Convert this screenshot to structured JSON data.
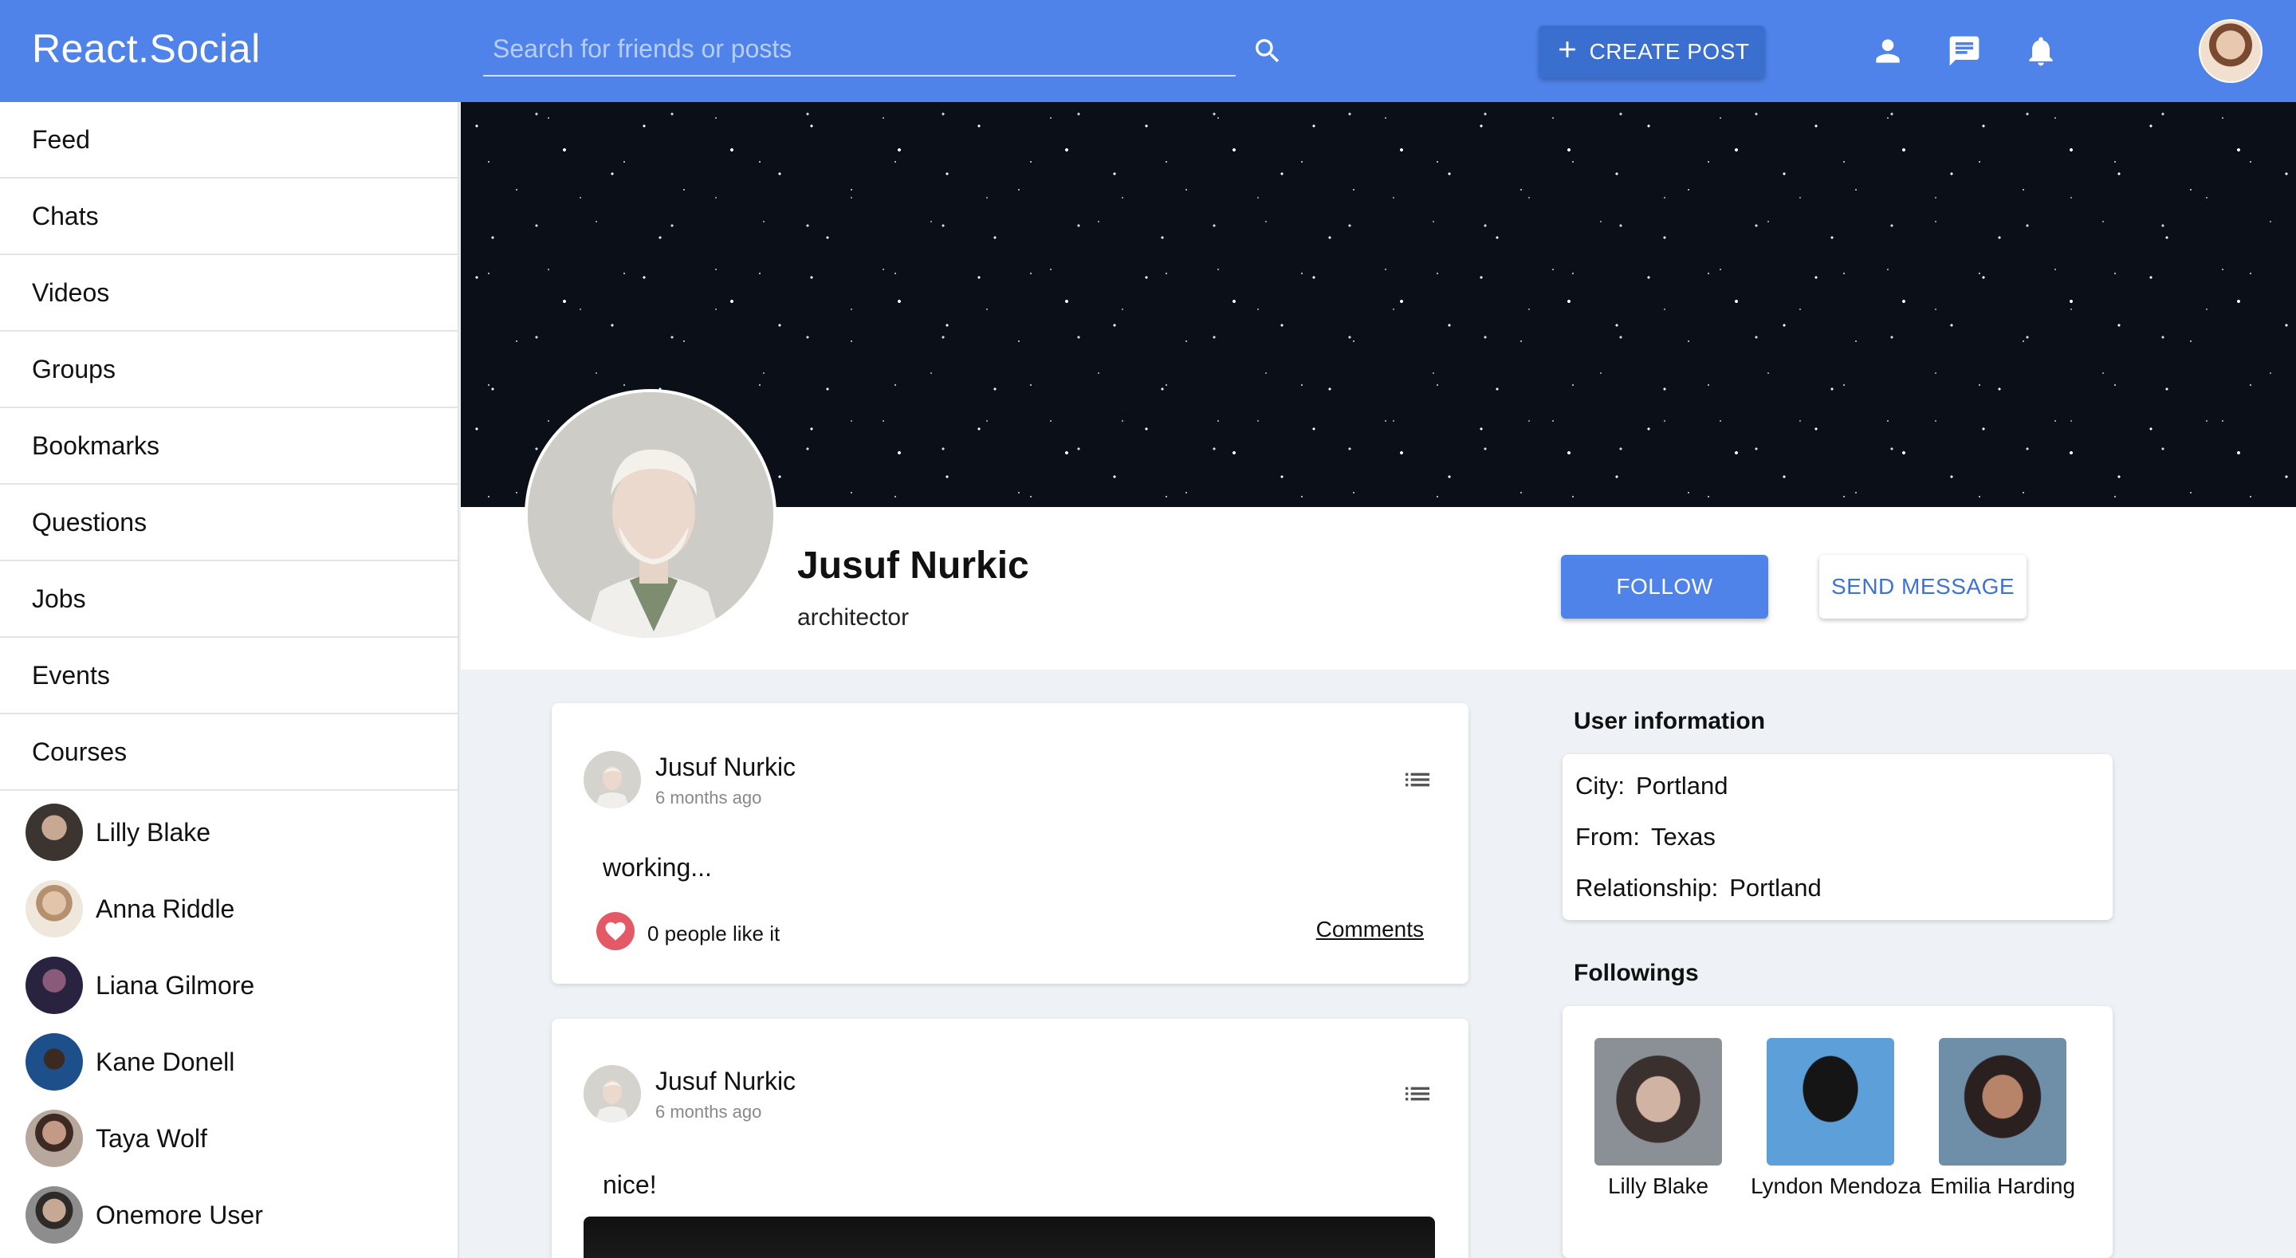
{
  "app": {
    "logo": "React.Social",
    "accent_color": "#4f83ea"
  },
  "header": {
    "search_placeholder": "Search for friends or posts",
    "create_post_label": "CREATE POST",
    "icons": [
      "search-icon",
      "person-icon",
      "chat-icon",
      "bell-icon"
    ]
  },
  "sidebar": {
    "nav": [
      {
        "label": "Feed"
      },
      {
        "label": "Chats"
      },
      {
        "label": "Videos"
      },
      {
        "label": "Groups"
      },
      {
        "label": "Bookmarks"
      },
      {
        "label": "Questions"
      },
      {
        "label": "Jobs"
      },
      {
        "label": "Events"
      },
      {
        "label": "Courses"
      }
    ],
    "friends": [
      {
        "name": "Lilly Blake"
      },
      {
        "name": "Anna Riddle"
      },
      {
        "name": "Liana Gilmore"
      },
      {
        "name": "Kane Donell"
      },
      {
        "name": "Taya Wolf"
      },
      {
        "name": "Onemore User"
      }
    ]
  },
  "profile": {
    "name": "Jusuf Nurkic",
    "description": "architector",
    "follow_label": "FOLLOW",
    "message_label": "SEND MESSAGE"
  },
  "posts": [
    {
      "author": "Jusuf Nurkic",
      "time": "6 months ago",
      "text": "working...",
      "likes": "0 people like it",
      "comments_label": "Comments"
    },
    {
      "author": "Jusuf Nurkic",
      "time": "6 months ago",
      "text": "nice!"
    }
  ],
  "user_info": {
    "title": "User information",
    "rows": [
      {
        "key": "City:",
        "value": "Portland"
      },
      {
        "key": "From:",
        "value": "Texas"
      },
      {
        "key": "Relationship:",
        "value": "Portland"
      }
    ]
  },
  "followings": {
    "title": "Followings",
    "people": [
      {
        "name": "Lilly Blake"
      },
      {
        "name": "Lyndon Mendoza"
      },
      {
        "name": "Emilia Harding"
      }
    ]
  }
}
